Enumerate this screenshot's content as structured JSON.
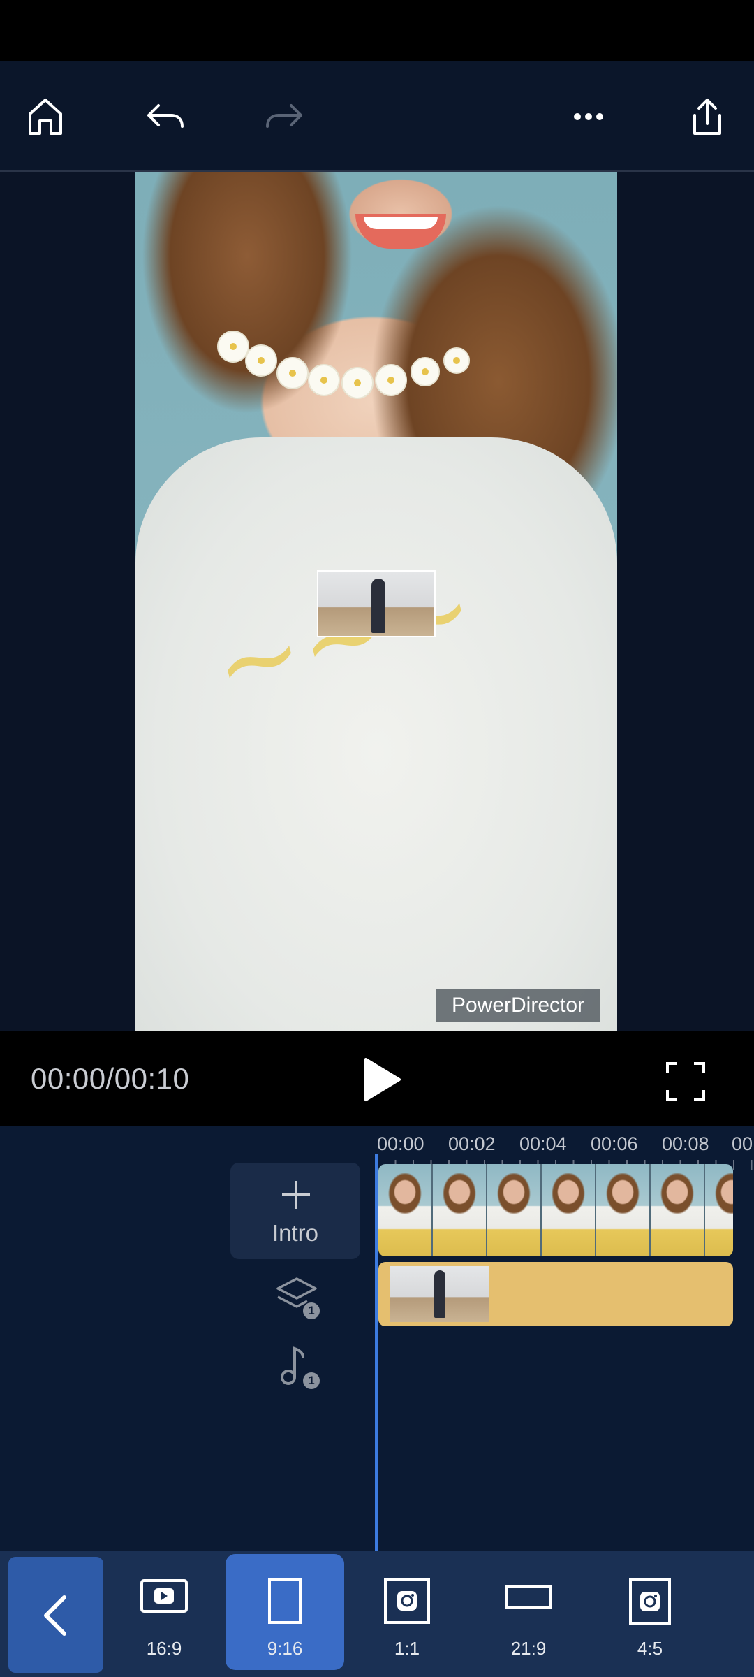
{
  "toolbar": {
    "home": "home-icon",
    "undo": "undo-icon",
    "redo": "redo-icon",
    "more": "more-icon",
    "export": "export-icon"
  },
  "preview": {
    "watermark": "PowerDirector"
  },
  "playback": {
    "timecode": "00:00/00:10"
  },
  "timeline": {
    "ruler": [
      "00:00",
      "00:02",
      "00:04",
      "00:06",
      "00:08",
      "00:"
    ],
    "intro_label": "Intro",
    "overlay_count": "1",
    "audio_count": "1"
  },
  "aspect_ratios": [
    {
      "label": "16:9",
      "icon": "youtube-icon"
    },
    {
      "label": "9:16",
      "icon": "portrait-icon",
      "selected": true
    },
    {
      "label": "1:1",
      "icon": "instagram-icon"
    },
    {
      "label": "21:9",
      "icon": "widescreen-icon"
    },
    {
      "label": "4:5",
      "icon": "instagram-icon"
    }
  ],
  "colors": {
    "accent": "#3a6cc6",
    "playhead": "#3d7be0",
    "overlay_track": "#e5bf6f"
  }
}
